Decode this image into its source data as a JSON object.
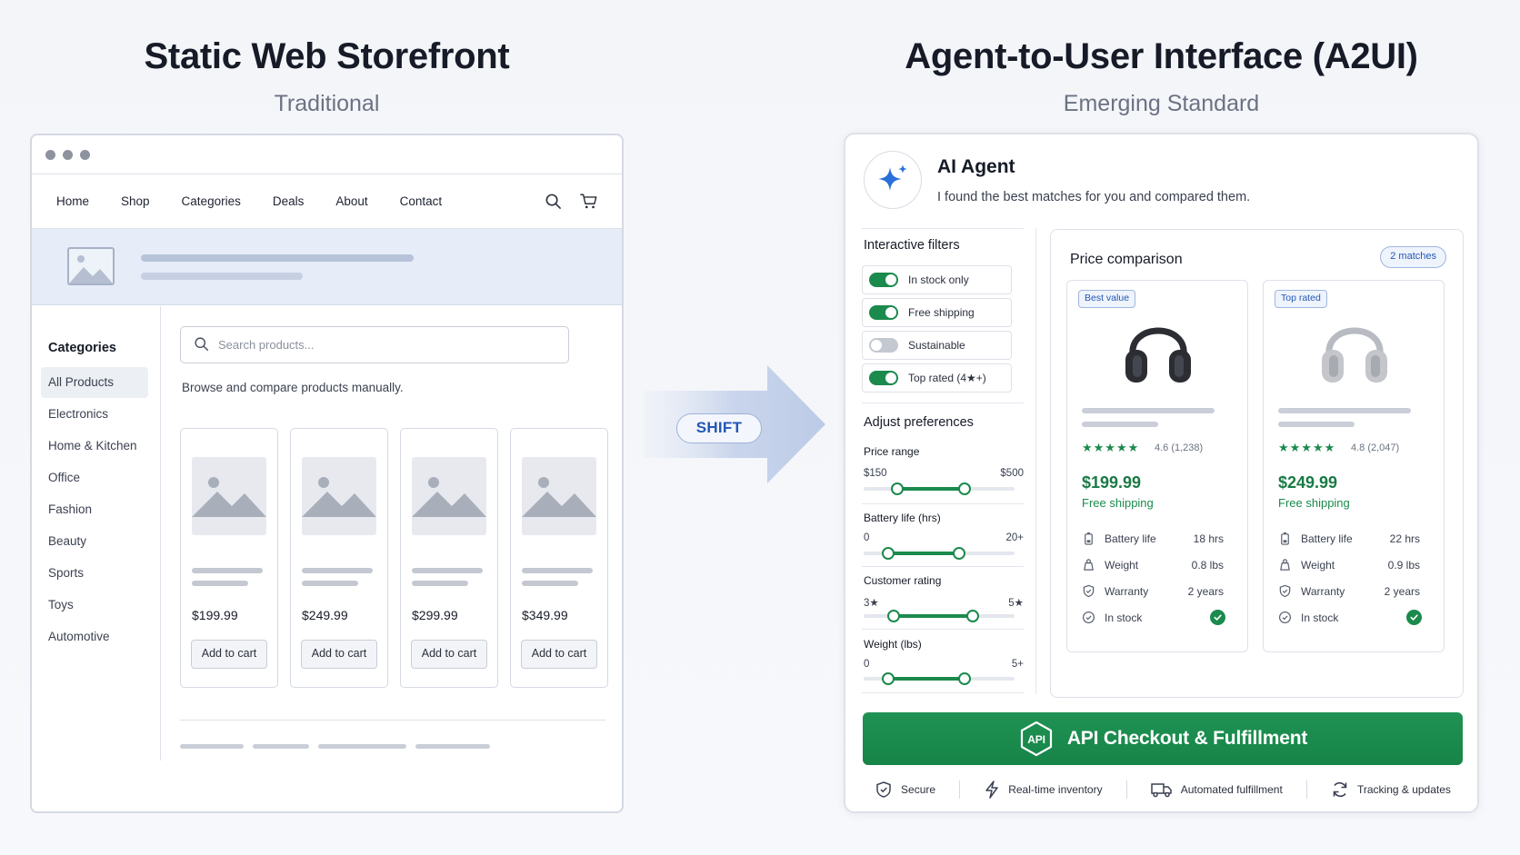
{
  "left": {
    "title": "Static Web Storefront",
    "subtitle": "Traditional",
    "nav": [
      "Home",
      "Shop",
      "Categories",
      "Deals",
      "About",
      "Contact"
    ],
    "categories_heading": "Categories",
    "categories": [
      "All Products",
      "Electronics",
      "Home & Kitchen",
      "Office",
      "Fashion",
      "Beauty",
      "Sports",
      "Toys",
      "Automotive"
    ],
    "search_placeholder": "Search products...",
    "browse_text": "Browse and compare products manually.",
    "products": [
      {
        "price": "$199.99",
        "button": "Add to cart"
      },
      {
        "price": "$249.99",
        "button": "Add to cart"
      },
      {
        "price": "$299.99",
        "button": "Add to cart"
      },
      {
        "price": "$349.99",
        "button": "Add to cart"
      }
    ]
  },
  "shift_label": "SHIFT",
  "right": {
    "title": "Agent-to-User Interface (A2UI)",
    "subtitle": "Emerging Standard",
    "agent_name": "AI Agent",
    "agent_message": "I found the best matches for you and compared them.",
    "filters_heading": "Interactive filters",
    "filters": [
      {
        "label": "In stock only",
        "on": true
      },
      {
        "label": "Free shipping",
        "on": true
      },
      {
        "label": "Sustainable",
        "on": false
      },
      {
        "label": "Top rated (4★+)",
        "on": true
      }
    ],
    "preferences_heading": "Adjust preferences",
    "sliders": [
      {
        "label": "Price range",
        "min_label": "$150",
        "max_label": "$500",
        "low": 0.22,
        "high": 0.67
      },
      {
        "label": "Battery life (hrs)",
        "min_label": "0",
        "max_label": "20+",
        "low": 0.16,
        "high": 0.63
      },
      {
        "label": "Customer rating",
        "min_label": "3★",
        "max_label": "5★",
        "low": 0.2,
        "high": 0.72
      },
      {
        "label": "Weight (lbs)",
        "min_label": "0",
        "max_label": "5+",
        "low": 0.16,
        "high": 0.67
      }
    ],
    "comparison_title": "Price comparison",
    "matches_label": "2 matches",
    "products": [
      {
        "badge": "Best value",
        "stars": "★★★★★",
        "rating": "4.6 (1,238)",
        "price": "$199.99",
        "shipping": "Free shipping",
        "color": "#2b2d33",
        "specs": [
          {
            "name": "Battery life",
            "value": "18 hrs"
          },
          {
            "name": "Weight",
            "value": "0.8 lbs"
          },
          {
            "name": "Warranty",
            "value": "2 years"
          },
          {
            "name": "In stock",
            "value": ""
          }
        ]
      },
      {
        "badge": "Top rated",
        "stars": "★★★★★",
        "rating": "4.8 (2,047)",
        "price": "$249.99",
        "shipping": "Free shipping",
        "color": "#c4c6cb",
        "specs": [
          {
            "name": "Battery life",
            "value": "22 hrs"
          },
          {
            "name": "Weight",
            "value": "0.9 lbs"
          },
          {
            "name": "Warranty",
            "value": "2 years"
          },
          {
            "name": "In stock",
            "value": ""
          }
        ]
      }
    ],
    "checkout_icon_text": "API",
    "checkout_label": "API Checkout & Fulfillment",
    "features": [
      "Secure",
      "Real-time inventory",
      "Automated fulfillment",
      "Tracking & updates"
    ]
  },
  "colors": {
    "accent_green": "#1b8a4d",
    "accent_blue": "#2458b5"
  }
}
